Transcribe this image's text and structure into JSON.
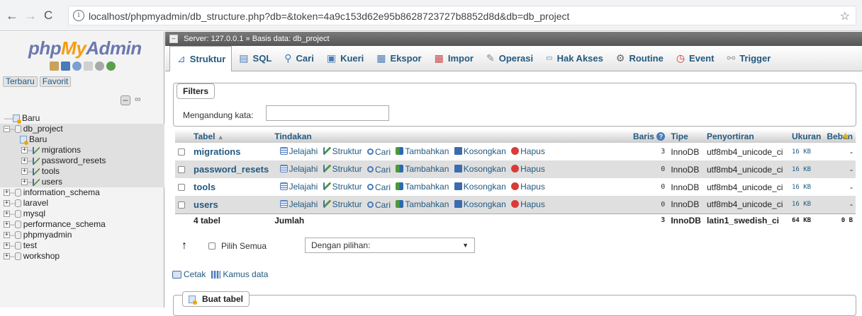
{
  "browser": {
    "url": "localhost/phpmyadmin/db_structure.php?db=&token=4a9c153d62e95b8628723727b8852d8d&db=db_project"
  },
  "sidebar": {
    "logo_php": "php",
    "logo_my": "My",
    "logo_admin": "Admin",
    "recent_label": "Terbaru",
    "favorite_label": "Favorit",
    "tree": {
      "new_root": "Baru",
      "db_project": "db_project",
      "db_new": "Baru",
      "tables": [
        "migrations",
        "password_resets",
        "tools",
        "users"
      ],
      "databases": [
        "information_schema",
        "laravel",
        "mysql",
        "performance_schema",
        "phpmyadmin",
        "test",
        "workshop"
      ]
    }
  },
  "breadcrumb": {
    "server": "Server: 127.0.0.1 »",
    "database": "Basis data: db_project"
  },
  "tabs": [
    {
      "label": "Struktur"
    },
    {
      "label": "SQL"
    },
    {
      "label": "Cari"
    },
    {
      "label": "Kueri"
    },
    {
      "label": "Ekspor"
    },
    {
      "label": "Impor"
    },
    {
      "label": "Operasi"
    },
    {
      "label": "Hak Akses"
    },
    {
      "label": "Routine"
    },
    {
      "label": "Event"
    },
    {
      "label": "Trigger"
    }
  ],
  "filters": {
    "legend": "Filters",
    "label": "Mengandung kata:",
    "value": ""
  },
  "table": {
    "headers": {
      "table": "Tabel",
      "actions": "Tindakan",
      "rows": "Baris",
      "type": "Tipe",
      "collation": "Penyortiran",
      "size": "Ukuran",
      "overhead": "Beban"
    },
    "actions": {
      "browse": "Jelajahi",
      "structure": "Struktur",
      "search": "Cari",
      "insert": "Tambahkan",
      "empty": "Kosongkan",
      "drop": "Hapus"
    },
    "rows": [
      {
        "name": "migrations",
        "rows": "3",
        "type": "InnoDB",
        "collation": "utf8mb4_unicode_ci",
        "size": "16 KB",
        "overhead": "-"
      },
      {
        "name": "password_resets",
        "rows": "0",
        "type": "InnoDB",
        "collation": "utf8mb4_unicode_ci",
        "size": "16 KB",
        "overhead": "-"
      },
      {
        "name": "tools",
        "rows": "0",
        "type": "InnoDB",
        "collation": "utf8mb4_unicode_ci",
        "size": "16 KB",
        "overhead": "-"
      },
      {
        "name": "users",
        "rows": "0",
        "type": "InnoDB",
        "collation": "utf8mb4_unicode_ci",
        "size": "16 KB",
        "overhead": "-"
      }
    ],
    "footer": {
      "count": "4 tabel",
      "sum_label": "Jumlah",
      "rows": "3",
      "type": "InnoDB",
      "collation": "latin1_swedish_ci",
      "size": "64 KB",
      "overhead": "0 B"
    }
  },
  "bulk": {
    "check_all": "Pilih Semua",
    "with_selected": "Dengan pilihan:"
  },
  "links": {
    "print": "Cetak",
    "data_dictionary": "Kamus data"
  },
  "create_table": {
    "legend": "Buat tabel"
  }
}
